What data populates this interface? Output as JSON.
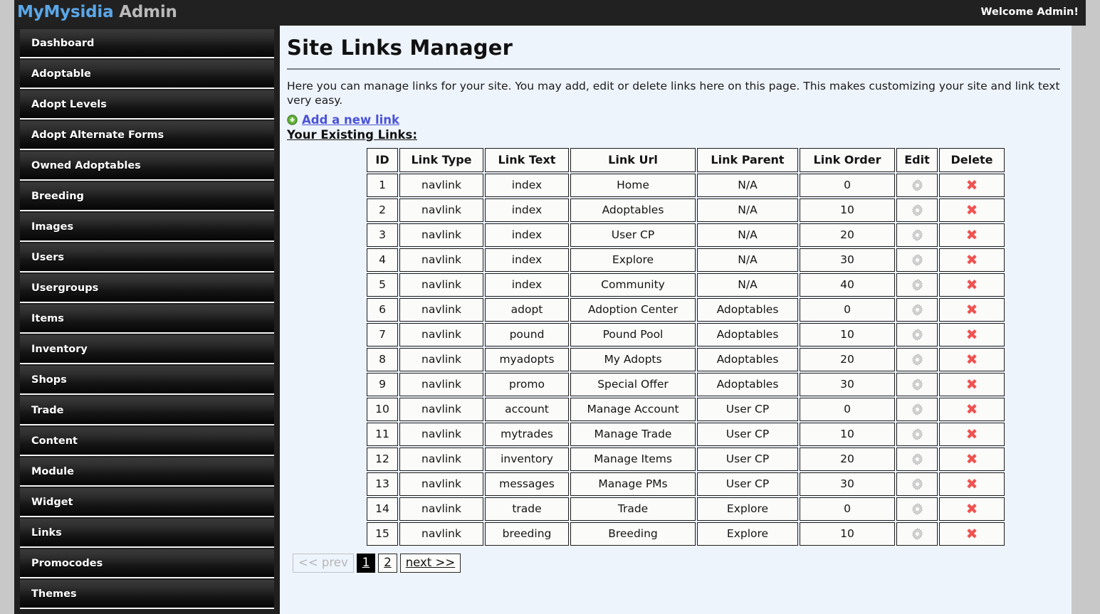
{
  "header": {
    "brand_primary": "MyMysidia",
    "brand_secondary": "Admin",
    "welcome": "Welcome Admin!",
    "brand_primary_color": "#5ba7e8",
    "brand_secondary_color": "#b9b9b9",
    "background_color": "#212121"
  },
  "sidebar": {
    "items": [
      {
        "label": "Dashboard"
      },
      {
        "label": "Adoptable"
      },
      {
        "label": "Adopt Levels"
      },
      {
        "label": "Adopt Alternate Forms"
      },
      {
        "label": "Owned Adoptables"
      },
      {
        "label": "Breeding"
      },
      {
        "label": "Images"
      },
      {
        "label": "Users"
      },
      {
        "label": "Usergroups"
      },
      {
        "label": "Items"
      },
      {
        "label": "Inventory"
      },
      {
        "label": "Shops"
      },
      {
        "label": "Trade"
      },
      {
        "label": "Content"
      },
      {
        "label": "Module"
      },
      {
        "label": "Widget"
      },
      {
        "label": "Links"
      },
      {
        "label": "Promocodes"
      },
      {
        "label": "Themes"
      }
    ]
  },
  "main": {
    "title": "Site Links Manager",
    "intro": "Here you can manage links for your site. You may add, edit or delete links here on this page. This makes customizing your site and link text very easy.",
    "add_link_label": "Add a new link",
    "add_link_icon": "plus-circle-icon",
    "add_link_color": "#4a53d6",
    "existing_links_label": "Your Existing Links:",
    "table": {
      "columns": [
        "ID",
        "Link Type",
        "Link Text",
        "Link Url",
        "Link Parent",
        "Link Order",
        "Edit",
        "Delete"
      ],
      "edit_icon": "gear-icon",
      "delete_icon": "red-x-icon",
      "delete_icon_color": "#ef5350",
      "rows": [
        {
          "id": "1",
          "link_type": "navlink",
          "link_text": "index",
          "link_url": "Home",
          "link_parent": "N/A",
          "link_order": "0"
        },
        {
          "id": "2",
          "link_type": "navlink",
          "link_text": "index",
          "link_url": "Adoptables",
          "link_parent": "N/A",
          "link_order": "10"
        },
        {
          "id": "3",
          "link_type": "navlink",
          "link_text": "index",
          "link_url": "User CP",
          "link_parent": "N/A",
          "link_order": "20"
        },
        {
          "id": "4",
          "link_type": "navlink",
          "link_text": "index",
          "link_url": "Explore",
          "link_parent": "N/A",
          "link_order": "30"
        },
        {
          "id": "5",
          "link_type": "navlink",
          "link_text": "index",
          "link_url": "Community",
          "link_parent": "N/A",
          "link_order": "40"
        },
        {
          "id": "6",
          "link_type": "navlink",
          "link_text": "adopt",
          "link_url": "Adoption Center",
          "link_parent": "Adoptables",
          "link_order": "0"
        },
        {
          "id": "7",
          "link_type": "navlink",
          "link_text": "pound",
          "link_url": "Pound Pool",
          "link_parent": "Adoptables",
          "link_order": "10"
        },
        {
          "id": "8",
          "link_type": "navlink",
          "link_text": "myadopts",
          "link_url": "My Adopts",
          "link_parent": "Adoptables",
          "link_order": "20"
        },
        {
          "id": "9",
          "link_type": "navlink",
          "link_text": "promo",
          "link_url": "Special Offer",
          "link_parent": "Adoptables",
          "link_order": "30"
        },
        {
          "id": "10",
          "link_type": "navlink",
          "link_text": "account",
          "link_url": "Manage Account",
          "link_parent": "User CP",
          "link_order": "0"
        },
        {
          "id": "11",
          "link_type": "navlink",
          "link_text": "mytrades",
          "link_url": "Manage Trade",
          "link_parent": "User CP",
          "link_order": "10"
        },
        {
          "id": "12",
          "link_type": "navlink",
          "link_text": "inventory",
          "link_url": "Manage Items",
          "link_parent": "User CP",
          "link_order": "20"
        },
        {
          "id": "13",
          "link_type": "navlink",
          "link_text": "messages",
          "link_url": "Manage PMs",
          "link_parent": "User CP",
          "link_order": "30"
        },
        {
          "id": "14",
          "link_type": "navlink",
          "link_text": "trade",
          "link_url": "Trade",
          "link_parent": "Explore",
          "link_order": "0"
        },
        {
          "id": "15",
          "link_type": "navlink",
          "link_text": "breeding",
          "link_url": "Breeding",
          "link_parent": "Explore",
          "link_order": "10"
        }
      ]
    },
    "pagination": {
      "prev_label": "<< prev",
      "prev_disabled": true,
      "pages": [
        {
          "label": "1",
          "active": true
        },
        {
          "label": "2",
          "active": false
        }
      ],
      "next_label": "next >>"
    }
  }
}
